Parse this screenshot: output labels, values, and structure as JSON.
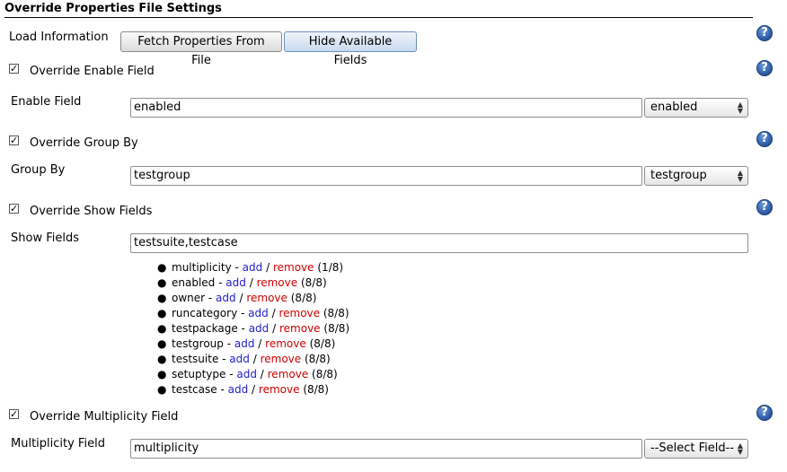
{
  "section": {
    "title": "Override Properties File Settings"
  },
  "load": {
    "label": "Load Information",
    "fetch_button": "Fetch Properties From File",
    "hide_button": "Hide Available Fields"
  },
  "enable": {
    "checkbox_label": "Override Enable Field",
    "checked": true,
    "field_label": "Enable Field",
    "value": "enabled",
    "select_value": "enabled"
  },
  "group": {
    "checkbox_label": "Override Group By",
    "checked": true,
    "field_label": "Group By",
    "value": "testgroup",
    "select_value": "testgroup"
  },
  "show": {
    "checkbox_label": "Override Show Fields",
    "checked": true,
    "field_label": "Show Fields",
    "value": "testsuite,testcase",
    "add_label": "add",
    "separator": "/",
    "remove_label": "remove",
    "fields": [
      {
        "name": "multiplicity",
        "count": "(1/8)"
      },
      {
        "name": "enabled",
        "count": "(8/8)"
      },
      {
        "name": "owner",
        "count": "(8/8)"
      },
      {
        "name": "runcategory",
        "count": "(8/8)"
      },
      {
        "name": "testpackage",
        "count": "(8/8)"
      },
      {
        "name": "testgroup",
        "count": "(8/8)"
      },
      {
        "name": "testsuite",
        "count": "(8/8)"
      },
      {
        "name": "setuptype",
        "count": "(8/8)"
      },
      {
        "name": "testcase",
        "count": "(8/8)"
      }
    ]
  },
  "multiplicity": {
    "checkbox_label": "Override Multiplicity Field",
    "checked": true,
    "field_label": "Multiplicity Field",
    "value": "multiplicity",
    "select_value": "--Select Field--"
  },
  "icons": {
    "help": "help-icon",
    "checkbox": "checkbox-checked-icon",
    "select_arrows": "chevron-up-down-icon"
  },
  "colors": {
    "link_add": "#2020cc",
    "link_remove": "#d00000",
    "help_icon": "#2f5fa8"
  }
}
